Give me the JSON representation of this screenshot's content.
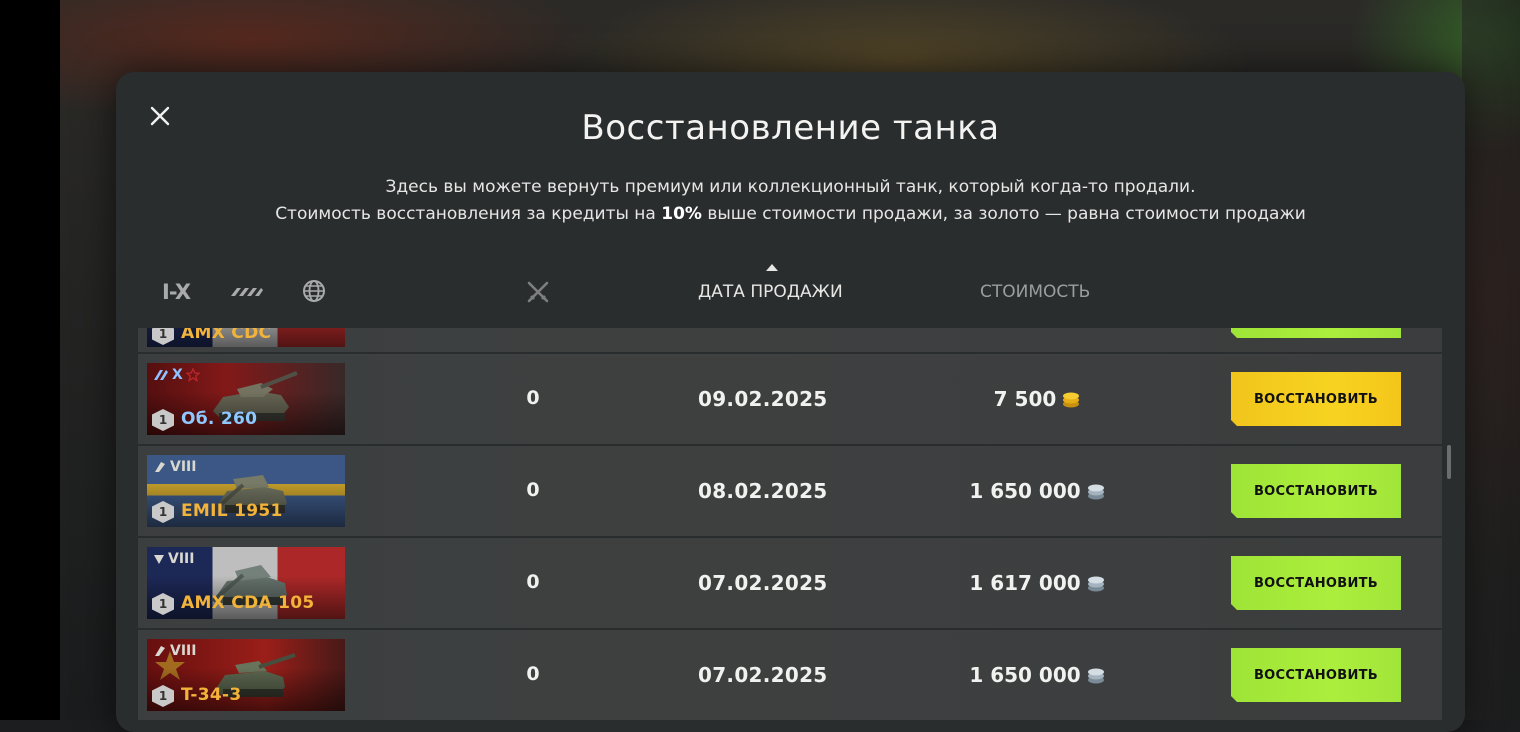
{
  "dialog": {
    "title": "Восстановление танка",
    "description_line1": "Здесь вы можете вернуть премиум или коллекционный танк, который когда-то продали.",
    "description_line2_before": "Стоимость восстановления за кредиты на ",
    "description_line2_bold": "10%",
    "description_line2_after": " выше стоимости продажи, за золото — равна стоимости продажи"
  },
  "filters": {
    "tier_label": "I-X"
  },
  "columns": {
    "date": "ДАТА ПРОДАЖИ",
    "cost": "СТОИМОСТЬ"
  },
  "partial_row": {
    "name": "AMX CDC"
  },
  "rows": [
    {
      "tier": "X",
      "name": "Об. 260",
      "level": "1",
      "battles": "0",
      "date": "09.02.2025",
      "cost": "7 500",
      "currency": "gold",
      "button": "ВОССТАНОВИТЬ"
    },
    {
      "tier": "VIII",
      "name": "EMIL 1951",
      "level": "1",
      "battles": "0",
      "date": "08.02.2025",
      "cost": "1 650 000",
      "currency": "credits",
      "button": "ВОССТАНОВИТЬ"
    },
    {
      "tier": "VIII",
      "name": "AMX CDA 105",
      "level": "1",
      "battles": "0",
      "date": "07.02.2025",
      "cost": "1 617 000",
      "currency": "credits",
      "button": "ВОССТАНОВИТЬ"
    },
    {
      "tier": "VIII",
      "name": "T-34-3",
      "level": "1",
      "battles": "0",
      "date": "07.02.2025",
      "cost": "1 650 000",
      "currency": "credits",
      "button": "ВОССТАНОВИТЬ"
    }
  ],
  "colors": {
    "gold_button": "#f5cc1f",
    "green_button": "#a6e93a",
    "tank_name": "#f2b33a",
    "premium_name": "#8fc7ff"
  }
}
